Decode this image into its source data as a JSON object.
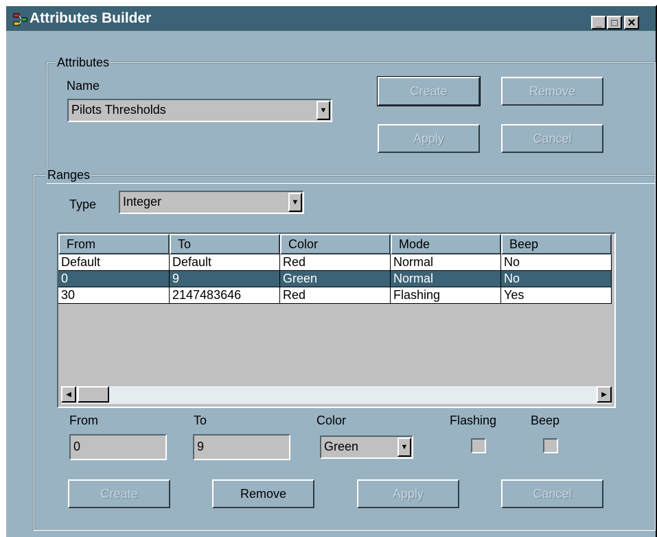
{
  "window": {
    "title": "Attributes Builder",
    "minimize_glyph": "_",
    "maximize_glyph": "□",
    "close_glyph": "✕"
  },
  "attributes": {
    "group_label": "Attributes",
    "name_label": "Name",
    "name_value": "Pilots Thresholds",
    "create_label": "Create",
    "remove_label": "Remove",
    "apply_label": "Apply",
    "cancel_label": "Cancel"
  },
  "ranges": {
    "group_label": "Ranges",
    "type_label": "Type",
    "type_value": "Integer",
    "columns": [
      "From",
      "To",
      "Color",
      "Mode",
      "Beep"
    ],
    "rows": [
      [
        "Default",
        "Default",
        "Red",
        "Normal",
        "No"
      ],
      [
        "0",
        "9",
        "Green",
        "Normal",
        "No"
      ],
      [
        "30",
        "2147483646",
        "Red",
        "Flashing",
        "Yes"
      ]
    ],
    "selected_row": 1,
    "from_label": "From",
    "from_value": "0",
    "to_label": "To",
    "to_value": "9",
    "color_label": "Color",
    "color_value": "Green",
    "flashing_label": "Flashing",
    "beep_label": "Beep",
    "create_label": "Create",
    "remove_label": "Remove",
    "apply_label": "Apply",
    "cancel_label": "Cancel"
  },
  "colors": {
    "window_bg": "#9ab3c3",
    "titlebar_bg": "#3b6275",
    "selection_bg": "#3b6275"
  }
}
